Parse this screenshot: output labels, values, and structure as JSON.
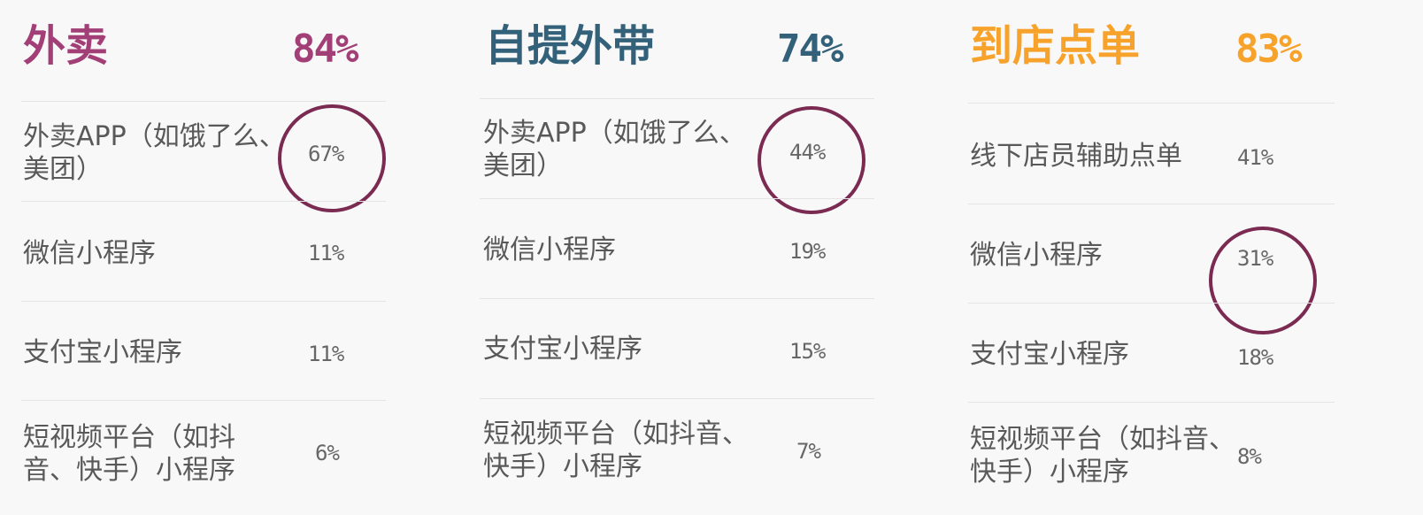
{
  "colors": {
    "waimai": "#a23f77",
    "ziti": "#336179",
    "daodian": "#f7a22b",
    "ring": "#7b2a52"
  },
  "panels": [
    {
      "title": "外卖",
      "total": "84%",
      "rows": [
        {
          "label": "外卖APP（如饿了么、\n美团）",
          "value": "67%",
          "circled": true
        },
        {
          "label": "微信小程序",
          "value": "11%",
          "circled": false
        },
        {
          "label": "支付宝小程序",
          "value": "11%",
          "circled": false
        },
        {
          "label": "短视频平台（如抖\n音、快手）小程序",
          "value": "6%",
          "circled": false
        }
      ]
    },
    {
      "title": "自提外带",
      "total": "74%",
      "rows": [
        {
          "label": "外卖APP（如饿了么、\n美团）",
          "value": "44%",
          "circled": true
        },
        {
          "label": "微信小程序",
          "value": "19%",
          "circled": false
        },
        {
          "label": "支付宝小程序",
          "value": "15%",
          "circled": false
        },
        {
          "label": "短视频平台（如抖音、\n快手）小程序",
          "value": "7%",
          "circled": false
        }
      ]
    },
    {
      "title": "到店点单",
      "total": "83%",
      "rows": [
        {
          "label": "线下店员辅助点单",
          "value": "41%",
          "circled": false
        },
        {
          "label": "微信小程序",
          "value": "31%",
          "circled": true
        },
        {
          "label": "支付宝小程序",
          "value": "18%",
          "circled": false
        },
        {
          "label": "短视频平台（如抖音、\n快手）小程序",
          "value": "8%",
          "circled": false
        }
      ]
    }
  ]
}
